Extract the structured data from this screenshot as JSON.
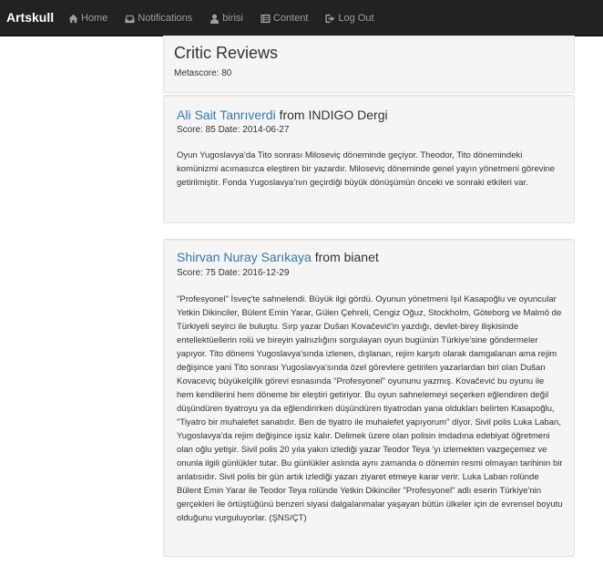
{
  "navbar": {
    "brand": "Artskull",
    "items": [
      {
        "label": "Home",
        "icon": "home-icon"
      },
      {
        "label": "Notifications",
        "icon": "inbox-icon"
      },
      {
        "label": "birisi",
        "icon": "user-icon"
      },
      {
        "label": "Content",
        "icon": "list-icon"
      },
      {
        "label": "Log Out",
        "icon": "logout-icon"
      }
    ]
  },
  "header": {
    "title": "Critic Reviews",
    "metascore": "Metascore: 80"
  },
  "reviews": [
    {
      "critic": "Ali Sait Tanrıverdi",
      "source": " from INDIGO Dergi",
      "meta": "Score: 85 Date: 2014-06-27",
      "body": "Oyun Yugoslavya’da Tito sonrası Miloseviç döneminde geçiyor. Theodor, Tito dönemindeki komünizmi acımasızca eleştiren bir yazardır. Miloseviç döneminde genel yayın yönetmeni görevine getirilmiştir. Fonda Yugoslavya’nın geçirdiği büyük dönüşümün önceki ve sonraki etkileri var."
    },
    {
      "critic": "Shirvan Nuray Sarıkaya",
      "source": " from bianet",
      "meta": "Score: 75 Date: 2016-12-29",
      "body": "\"Profesyonel\" İsveç'te sahnelendi. Büyük ilgi gördü. Oyunun yönetmeni Işıl Kasapoğlu ve oyuncular Yetkin Dikinciler, Bülent Emin Yarar, Gülen Çehreli, Cengiz Oğuz, Stockholm, Göteborg ve Malmö de Türkiyeli seyirci ile buluştu. Sırp yazar Dušan Kovačević'in yazdığı, devlet-birey ilişkisinde entellektüellerin rolü ve bireyin yalnızlığını sorgulayan oyun bugünün Türkiye'sine göndermeler yapıyor. Tito dönemi Yugoslavya'sında izlenen, dışlanan, rejim karşıtı olarak damgalanan ama rejim değişince yani Tito sonrası Yugoslavya'sında özel görevlere getirilen yazarlardan biri olan Dušan Kovaceviç büyükelçilik görevi esnasında \"Profesyonel\" oyununu yazmış. Kovačević bu oyunu ile hem kendilerini hem döneme bir eleştiri getiriyor. Bu oyun sahnelemeyi seçerken eğlendiren değil düşündüren tiyatroyu ya da eğlendirirken düşündüren tiyatrodan yana oldukları belirten Kasapoğlu, \"Tiyatro bir muhalefet sanatıdır. Ben de tiyatro ile muhalefet yapıyorum\" diyor. Sivil polis Luka Laban, Yugoslavya'da rejim değişince işsiz kalır. Delimek üzere olan polisin imdadına edebiyat öğretmeni olan oğlu yetişir. Sivil polis 20 yıla yakın izlediği yazar Teodor Teya 'yı izlemekten vazgeçemez ve onunla ilgili günlükler tutar. Bu günlükler aslında aynı zamanda o dönemin resmi olmayan tarihinin bir anlatısıdır. Sivil polis bir gün artık izlediği yazarı ziyaret etmeye karar verir. Luka Laban rolünde Bülent Emin Yarar ile Teodor Teya rolünde Yetkin Dikinciler \"Profesyonel\" adlı eserin Türkiye'nin gerçekleri ile örtüştüğünü benzeri siyasi dalgalanmalar yaşayan bütün ülkeler için de evrensel boyutu olduğunu vurguluyorlar. (ŞNS/ÇT)"
    }
  ],
  "colors": {
    "navbar_bg": "#222222",
    "nav_text": "#9d9d9d",
    "link": "#337ab7",
    "well_bg": "#f5f5f5"
  }
}
